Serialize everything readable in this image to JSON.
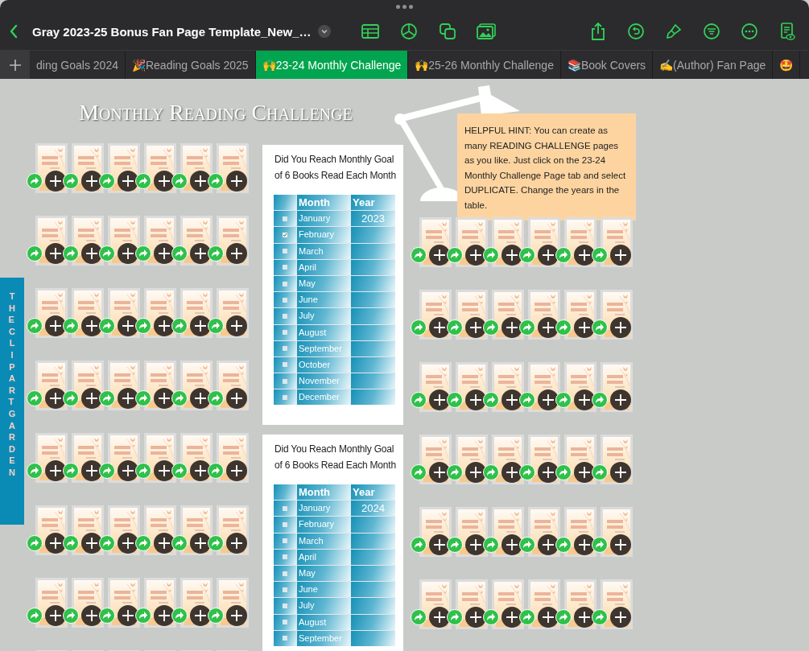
{
  "toolbar": {
    "title": "Gray 2023-25 Bonus Fan Page Template_New_…"
  },
  "tabs": [
    {
      "label": "ding Goals 2024",
      "selected": false
    },
    {
      "label": "🎉Reading Goals 2025",
      "selected": false
    },
    {
      "label": "🙌23-24 Monthly Challenge",
      "selected": true
    },
    {
      "label": "🙌25-26 Monthly Challenge",
      "selected": false
    },
    {
      "label": "📚Book Covers",
      "selected": false
    },
    {
      "label": "✍️(Author) Fan Page",
      "selected": false
    },
    {
      "label": "🤩",
      "selected": false
    }
  ],
  "page": {
    "heading": "Monthly Reading Challenge",
    "hint": "HELPFUL HINT: You can create as many READING CHALLENGE pages as you like. Just click on the 23-24 Monthly Challenge Page tab and select DUPLICATE. Change the years in the table.",
    "side_banner": "THE CLIPART GARDEN",
    "goal_tables": [
      {
        "title": "Did You Reach Monthly Goal of 6 Books Read Each Month",
        "columns": [
          "Month",
          "Year"
        ],
        "rows": [
          {
            "checked": false,
            "month": "January",
            "year": "2023"
          },
          {
            "checked": true,
            "month": "February"
          },
          {
            "checked": false,
            "month": "March"
          },
          {
            "checked": false,
            "month": "April"
          },
          {
            "checked": false,
            "month": "May"
          },
          {
            "checked": false,
            "month": "June"
          },
          {
            "checked": false,
            "month": "July"
          },
          {
            "checked": false,
            "month": "August"
          },
          {
            "checked": false,
            "month": "September"
          },
          {
            "checked": false,
            "month": "October"
          },
          {
            "checked": false,
            "month": "November"
          },
          {
            "checked": false,
            "month": "December"
          }
        ]
      },
      {
        "title": "Did You Reach Monthly Goal of 6 Books Read Each Month",
        "columns": [
          "Month",
          "Year"
        ],
        "rows": [
          {
            "checked": false,
            "month": "January",
            "year": "2024"
          },
          {
            "checked": false,
            "month": "February"
          },
          {
            "checked": false,
            "month": "March"
          },
          {
            "checked": false,
            "month": "April"
          },
          {
            "checked": false,
            "month": "May"
          },
          {
            "checked": false,
            "month": "June"
          },
          {
            "checked": false,
            "month": "July"
          },
          {
            "checked": false,
            "month": "August"
          },
          {
            "checked": false,
            "month": "September"
          }
        ]
      }
    ]
  }
}
